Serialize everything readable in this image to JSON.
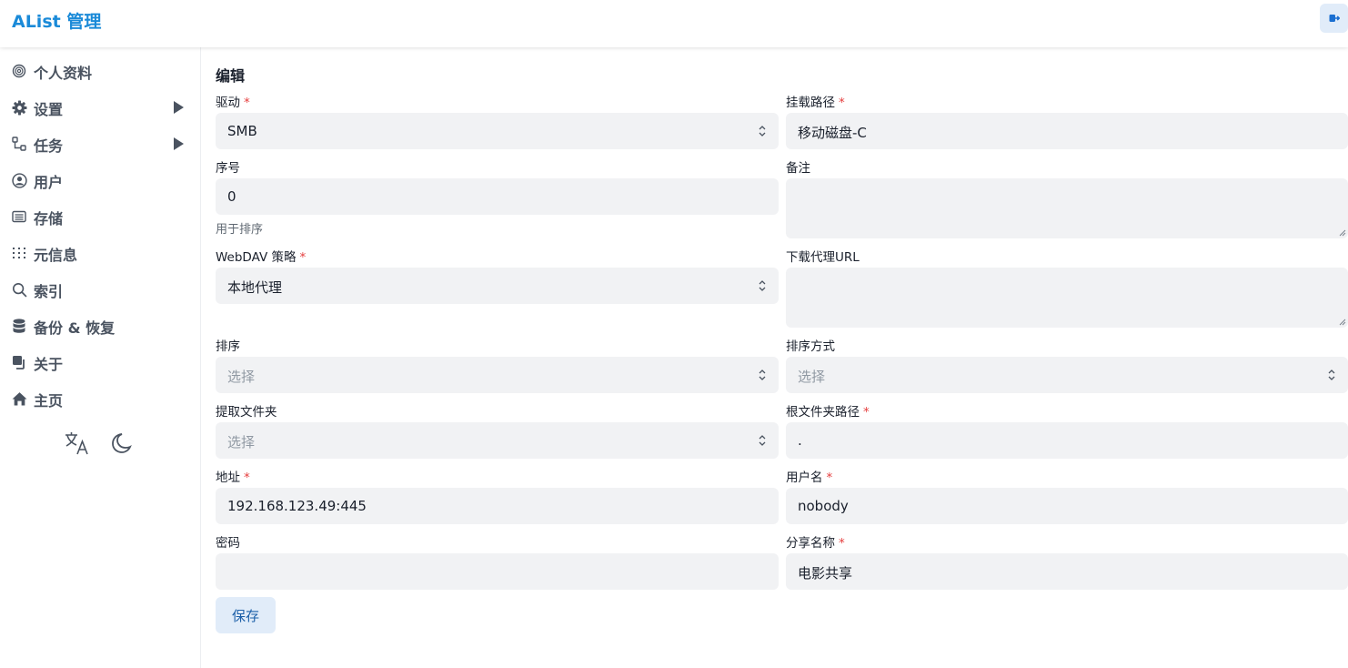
{
  "app": {
    "title": "AList 管理"
  },
  "header": {
    "logout_icon": "logout-icon"
  },
  "sidebar": {
    "items": [
      {
        "label": "个人资料",
        "icon": "fingerprint-icon"
      },
      {
        "label": "设置",
        "icon": "gear-icon",
        "expandable": true
      },
      {
        "label": "任务",
        "icon": "flow-icon",
        "expandable": true
      },
      {
        "label": "用户",
        "icon": "user-circle-icon"
      },
      {
        "label": "存储",
        "icon": "storage-icon"
      },
      {
        "label": "元信息",
        "icon": "metadata-icon"
      },
      {
        "label": "索引",
        "icon": "search-icon"
      },
      {
        "label": "备份 & 恢复",
        "icon": "database-icon"
      },
      {
        "label": "关于",
        "icon": "copy-icon"
      },
      {
        "label": "主页",
        "icon": "home-icon"
      }
    ],
    "utils": {
      "language_icon": "translate-icon",
      "theme_icon": "moon-icon"
    }
  },
  "form": {
    "title": "编辑",
    "driver": {
      "label": "驱动",
      "required": "*",
      "value": "SMB"
    },
    "mount_path": {
      "label": "挂载路径",
      "required": "*",
      "value": "移动磁盘-C"
    },
    "order": {
      "label": "序号",
      "value": "0",
      "hint": "用于排序"
    },
    "remark": {
      "label": "备注",
      "value": ""
    },
    "webdav_policy": {
      "label": "WebDAV 策略",
      "required": "*",
      "value": "本地代理"
    },
    "proxy_url": {
      "label": "下载代理URL",
      "value": ""
    },
    "order_by": {
      "label": "排序",
      "placeholder": "选择"
    },
    "order_direction": {
      "label": "排序方式",
      "placeholder": "选择"
    },
    "extract_folder": {
      "label": "提取文件夹",
      "placeholder": "选择"
    },
    "root_folder_path": {
      "label": "根文件夹路径",
      "required": "*",
      "value": "."
    },
    "address": {
      "label": "地址",
      "required": "*",
      "value": "192.168.123.49:445"
    },
    "username": {
      "label": "用户名",
      "required": "*",
      "value": "nobody"
    },
    "password": {
      "label": "密码",
      "value": ""
    },
    "share_name": {
      "label": "分享名称",
      "required": "*",
      "value": "电影共享"
    },
    "save_label": "保存"
  },
  "colors": {
    "brand": "#1a8ad8",
    "required": "#e53e3e",
    "field_bg": "#f1f2f4",
    "button_bg": "#e1ecf9"
  }
}
